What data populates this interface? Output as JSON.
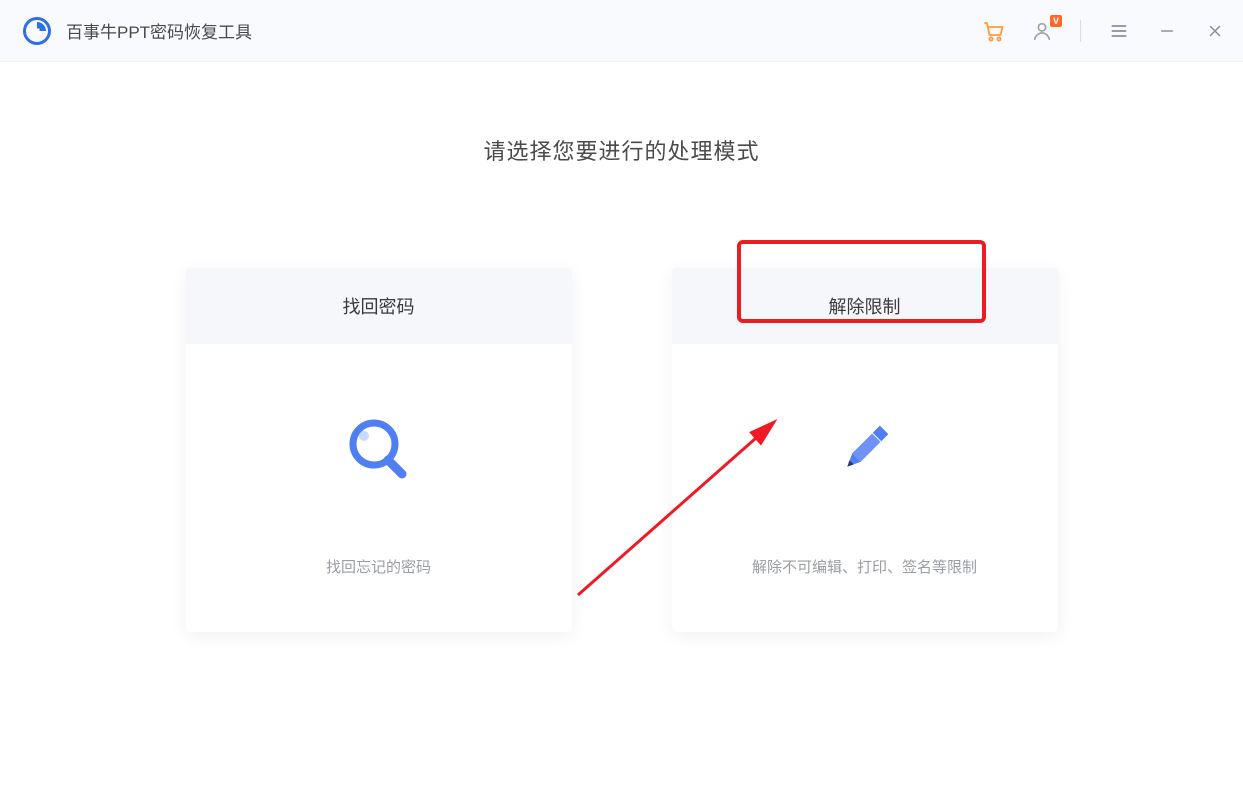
{
  "titlebar": {
    "app_title": "百事牛PPT密码恢复工具"
  },
  "main": {
    "prompt": "请选择您要进行的处理模式"
  },
  "cards": {
    "recover": {
      "title": "找回密码",
      "desc": "找回忘记的密码"
    },
    "unlock": {
      "title": "解除限制",
      "desc": "解除不可编辑、打印、签名等限制"
    }
  }
}
